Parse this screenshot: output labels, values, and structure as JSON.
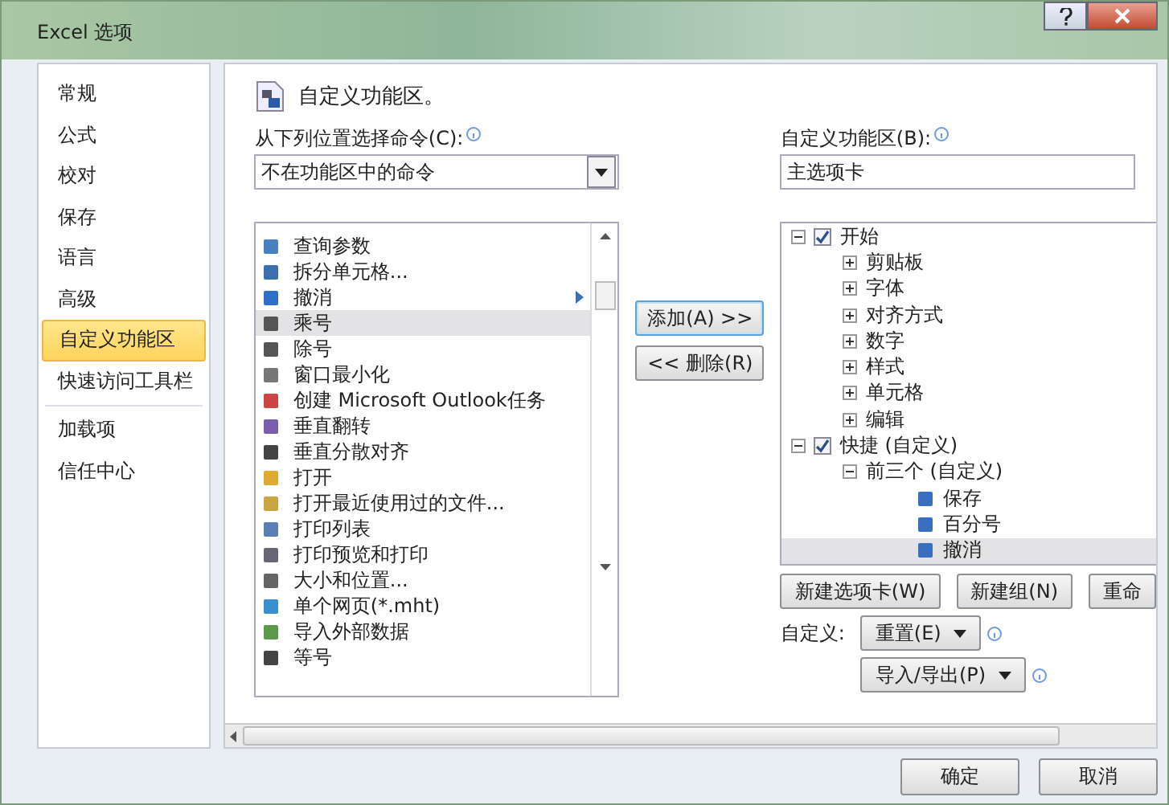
{
  "window": {
    "title": "Excel 选项"
  },
  "nav": [
    [
      {
        "label": "常规",
        "selected": false
      },
      {
        "label": "公式",
        "selected": false
      },
      {
        "label": "校对",
        "selected": false
      },
      {
        "label": "保存",
        "selected": false
      },
      {
        "label": "语言",
        "selected": false
      },
      {
        "label": "高级",
        "selected": false
      },
      {
        "label": "自定义功能区",
        "selected": true
      },
      {
        "label": "快速访问工具栏",
        "selected": false
      }
    ],
    [
      {
        "label": "加载项",
        "selected": false
      },
      {
        "label": "信任中心",
        "selected": false
      }
    ]
  ],
  "header": {
    "title": "自定义功能区。"
  },
  "source": {
    "label": "从下列位置选择命令(C):",
    "value": "不在功能区中的命令"
  },
  "commands": [
    {
      "label": "查询参数",
      "selected": false,
      "submenu": false
    },
    {
      "label": "拆分单元格...",
      "selected": false,
      "submenu": false
    },
    {
      "label": "撤消",
      "selected": false,
      "submenu": true
    },
    {
      "label": "乘号",
      "selected": true,
      "submenu": false
    },
    {
      "label": "除号",
      "selected": false,
      "submenu": false
    },
    {
      "label": "窗口最小化",
      "selected": false,
      "submenu": false
    },
    {
      "label": "创建 Microsoft Outlook任务",
      "selected": false,
      "submenu": false
    },
    {
      "label": "垂直翻转",
      "selected": false,
      "submenu": false
    },
    {
      "label": "垂直分散对齐",
      "selected": false,
      "submenu": false
    },
    {
      "label": "打开",
      "selected": false,
      "submenu": false
    },
    {
      "label": "打开最近使用过的文件...",
      "selected": false,
      "submenu": false
    },
    {
      "label": "打印列表",
      "selected": false,
      "submenu": false
    },
    {
      "label": "打印预览和打印",
      "selected": false,
      "submenu": false
    },
    {
      "label": "大小和位置...",
      "selected": false,
      "submenu": false
    },
    {
      "label": "单个网页(*.mht)",
      "selected": false,
      "submenu": false
    },
    {
      "label": "导入外部数据",
      "selected": false,
      "submenu": false
    },
    {
      "label": "等号",
      "selected": false,
      "submenu": false
    }
  ],
  "add_button": "添加(A) >>",
  "remove_button": "<< 删除(R)",
  "target": {
    "label": "自定义功能区(B):",
    "value": "主选项卡",
    "tree": [
      {
        "label": "开始",
        "checked": true,
        "expanded": true,
        "selected": false,
        "children": [
          {
            "label": "剪贴板",
            "expanded": false,
            "selected": false
          },
          {
            "label": "字体",
            "expanded": false,
            "selected": false
          },
          {
            "label": "对齐方式",
            "expanded": false,
            "selected": false
          },
          {
            "label": "数字",
            "expanded": false,
            "selected": false
          },
          {
            "label": "样式",
            "expanded": false,
            "selected": false
          },
          {
            "label": "单元格",
            "expanded": false,
            "selected": false
          },
          {
            "label": "编辑",
            "expanded": false,
            "selected": false
          }
        ]
      },
      {
        "label": "快捷 (自定义)",
        "checked": true,
        "expanded": true,
        "selected": false,
        "children": [
          {
            "label": "前三个 (自定义)",
            "expanded": true,
            "selected": false,
            "children": [
              {
                "label": "保存",
                "selected": false
              },
              {
                "label": "百分号",
                "selected": false
              },
              {
                "label": "撤消",
                "selected": true
              }
            ]
          }
        ]
      }
    ]
  },
  "tree_buttons": [
    "新建选项卡(W)",
    "新建组(N)",
    "重命"
  ],
  "customize": {
    "label": "自定义:",
    "reset": "重置(E)",
    "import_export": "导入/导出(P)"
  },
  "footer": [
    "确定",
    "取消"
  ]
}
